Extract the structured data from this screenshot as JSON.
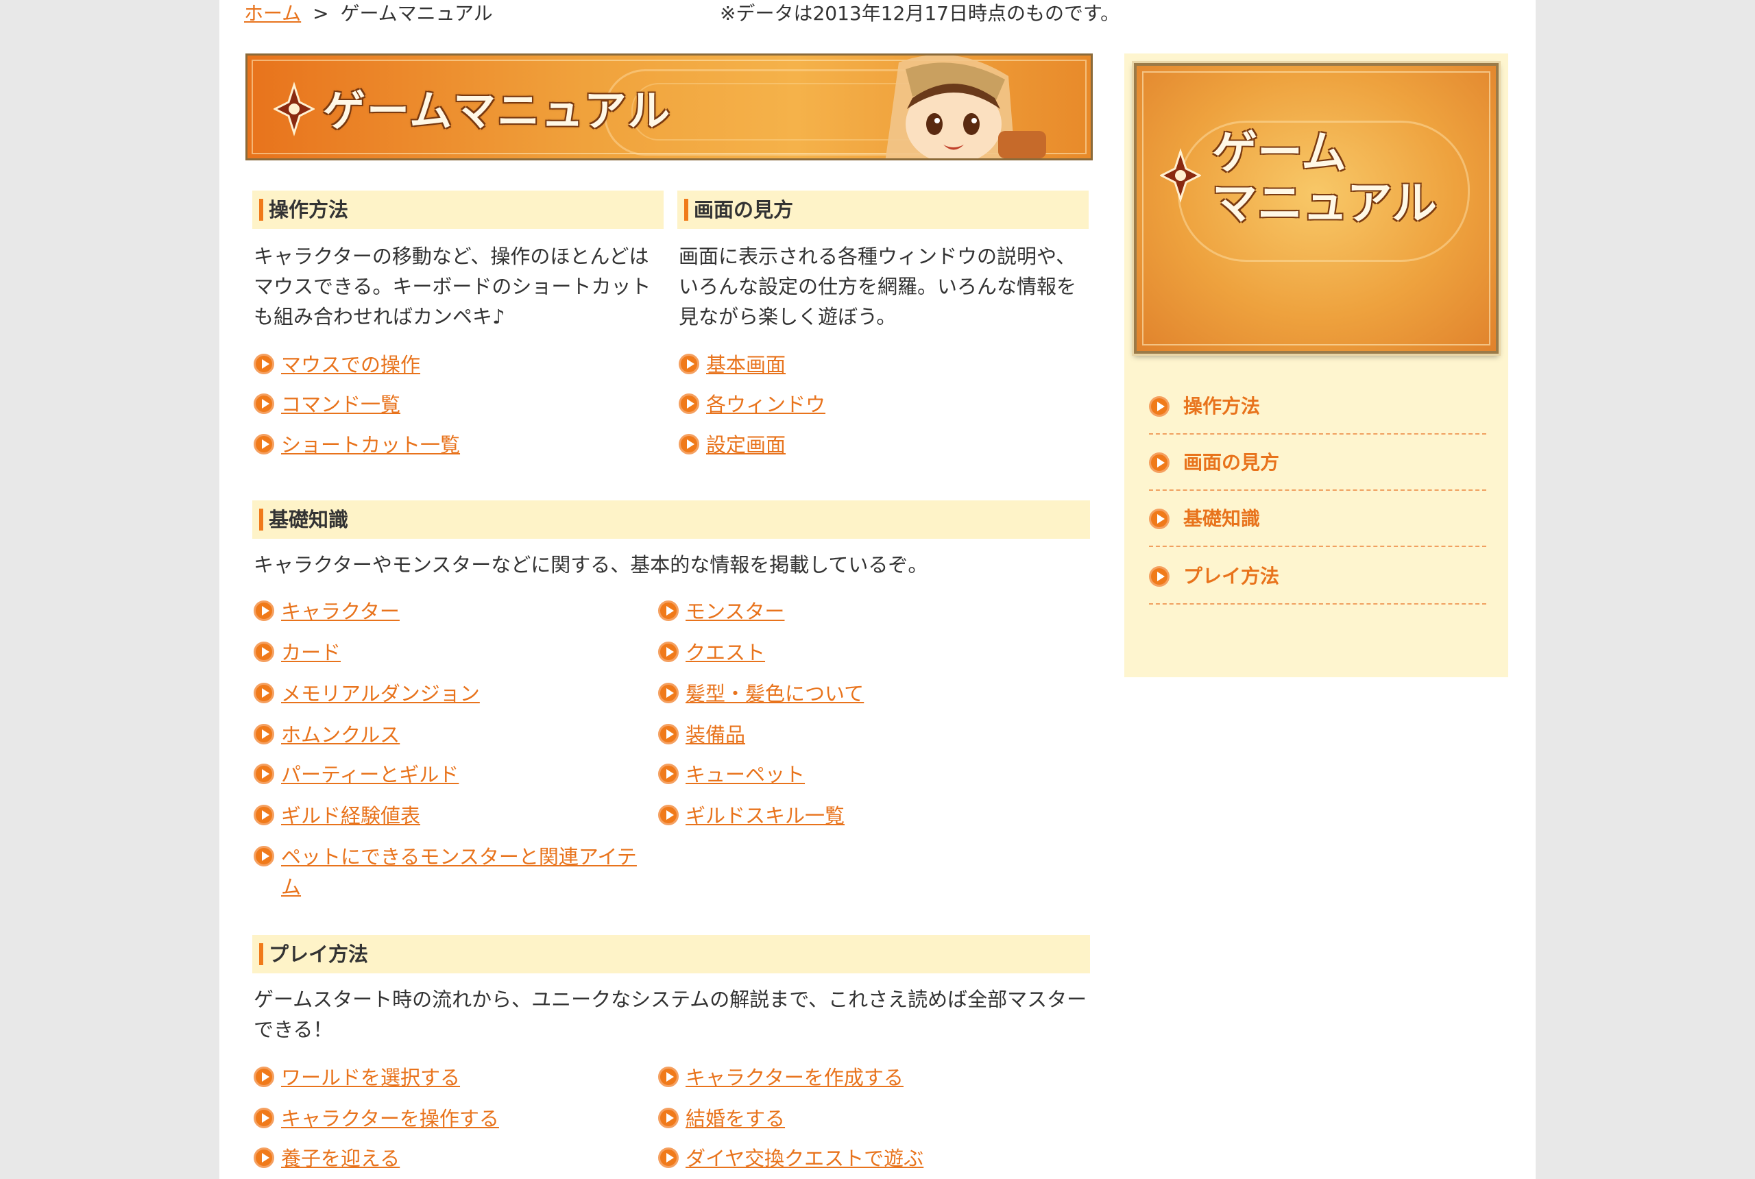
{
  "breadcrumb": {
    "home": "ホーム",
    "separator": ">",
    "current": "ゲームマニュアル"
  },
  "data_note": "※データは2013年12月17日時点のものです。",
  "banner": {
    "title": "ゲームマニュアル"
  },
  "sections": {
    "controls": {
      "heading": "操作方法",
      "description": "キャラクターの移動など、操作のほとんどはマウスできる。キーボードのショートカットも組み合わせればカンペキ♪",
      "links": [
        "マウスでの操作",
        "コマンド一覧",
        "ショートカット一覧"
      ]
    },
    "screen": {
      "heading": "画面の見方",
      "description": "画面に表示される各種ウィンドウの説明や、いろんな設定の仕方を網羅。いろんな情報を見ながら楽しく遊ぼう。",
      "links": [
        "基本画面",
        "各ウィンドウ",
        "設定画面"
      ]
    },
    "basics": {
      "heading": "基礎知識",
      "description": "キャラクターやモンスターなどに関する、基本的な情報を掲載しているぞ。",
      "links_left": [
        "キャラクター",
        "カード",
        "メモリアルダンジョン",
        "ホムンクルス",
        "パーティーとギルド",
        "ギルド経験値表",
        "ペットにできるモンスターと関連アイテム"
      ],
      "links_right": [
        "モンスター",
        "クエスト",
        "髪型・髪色について",
        "装備品",
        "キューペット",
        "ギルドスキル一覧"
      ]
    },
    "play": {
      "heading": "プレイ方法",
      "description": "ゲームスタート時の流れから、ユニークなシステムの解説まで、これさえ読めば全部マスターできる！",
      "links_left": [
        "ワールドを選択する",
        "キャラクターを操作する",
        "養子を迎える"
      ],
      "links_right": [
        "キャラクターを作成する",
        "結婚をする",
        "ダイヤ交換クエストで遊ぶ"
      ]
    }
  },
  "sidebar": {
    "banner_title_line1": "ゲーム",
    "banner_title_line2": "マニュアル",
    "nav": [
      "操作方法",
      "画面の見方",
      "基礎知識",
      "プレイ方法"
    ]
  },
  "colors": {
    "accent": "#e8731c",
    "header_bg": "#fef3c8",
    "sidebar_bg": "#fef5cf"
  }
}
